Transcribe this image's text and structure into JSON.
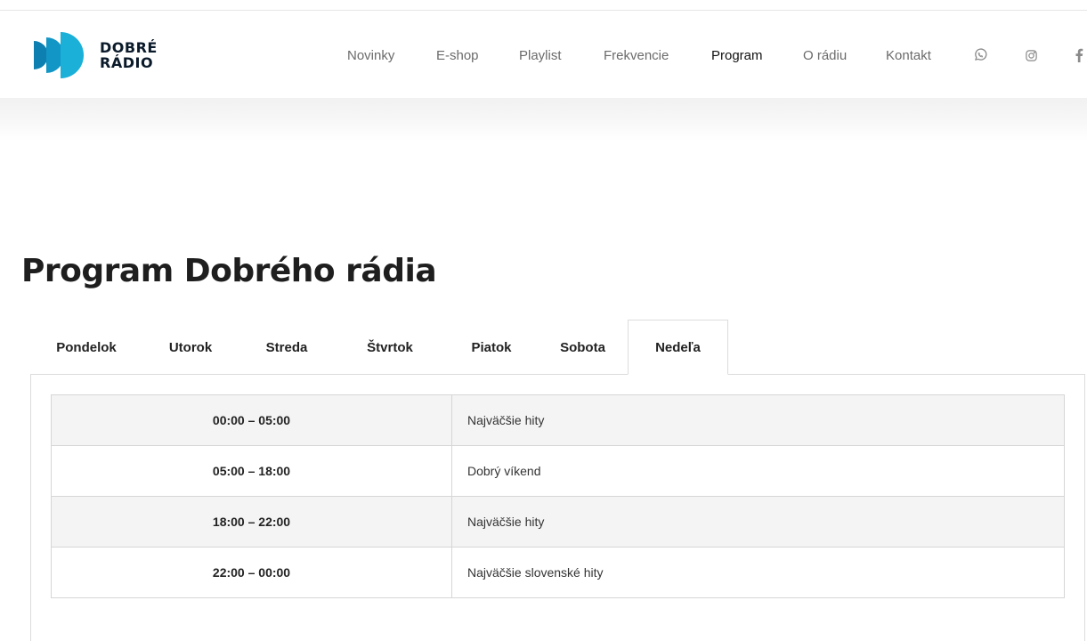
{
  "brand": {
    "line1": "DOBRÉ",
    "line2": "RÁDIO",
    "color": "#1ab0d8"
  },
  "nav": {
    "items": [
      {
        "label": "Novinky"
      },
      {
        "label": "E-shop"
      },
      {
        "label": "Playlist"
      },
      {
        "label": "Frekvencie"
      },
      {
        "label": "Program",
        "active": true
      },
      {
        "label": "O rádiu"
      },
      {
        "label": "Kontakt"
      }
    ],
    "icons": [
      "whatsapp-icon",
      "instagram-icon",
      "facebook-icon"
    ]
  },
  "page": {
    "title": "Program Dobrého rádia"
  },
  "tabs": [
    {
      "label": "Pondelok"
    },
    {
      "label": "Utorok"
    },
    {
      "label": "Streda"
    },
    {
      "label": "Štvrtok"
    },
    {
      "label": "Piatok"
    },
    {
      "label": "Sobota"
    },
    {
      "label": "Nedeľa",
      "active": true
    }
  ],
  "schedule": [
    {
      "time": "00:00 – 05:00",
      "show": "Najväčšie hity"
    },
    {
      "time": "05:00 – 18:00",
      "show": "Dobrý víkend"
    },
    {
      "time": "18:00 – 22:00",
      "show": "Najväčšie hity"
    },
    {
      "time": "22:00 – 00:00",
      "show": "Najväčšie slovenské hity"
    }
  ]
}
